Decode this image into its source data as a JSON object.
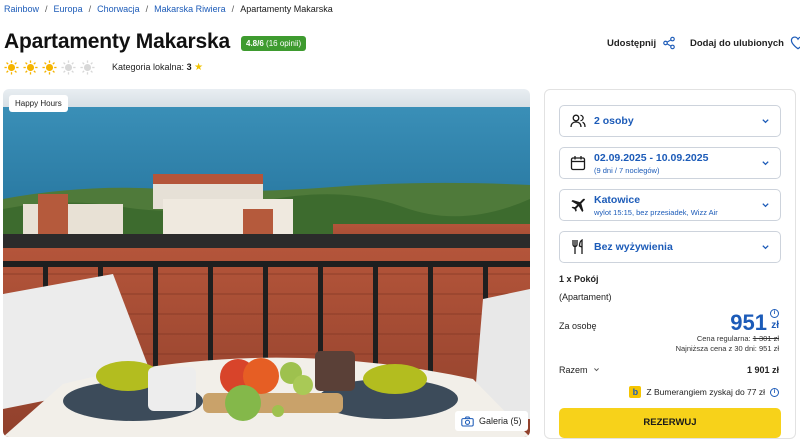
{
  "breadcrumb": {
    "items": [
      "Rainbow",
      "Europa",
      "Chorwacja",
      "Makarska Riwiera"
    ],
    "current": "Apartamenty Makarska",
    "separator": "/"
  },
  "hotel": {
    "name": "Apartamenty Makarska",
    "rating": "4.8/6",
    "rating_count": "(16 opinii)",
    "suns_filled": 3,
    "suns_total": 5,
    "local_category_label": "Kategoria lokalna:",
    "local_category_value": "3",
    "local_category_icon": "star-icon"
  },
  "actions": {
    "share_label": "Udostępnij",
    "favorite_label": "Dodaj do ulubionych"
  },
  "photo": {
    "badge": "Happy Hours",
    "gallery_label": "Galeria (5)"
  },
  "booking": {
    "persons": "2 osoby",
    "dates": "02.09.2025 - 10.09.2025",
    "dates_sub": "(9 dni / 7 noclegów)",
    "departure_city": "Katowice",
    "departure_sub": "wylot 15:15, bez przesiadek, Wizz Air",
    "board": "Bez wyżywienia",
    "room": "1 x Pokój",
    "room_type": "(Apartament)",
    "per_person_label": "Za osobę",
    "price": "951",
    "currency": "zł",
    "regular_price_label": "Cena regularna:",
    "regular_price": "1 301 zł",
    "lowest_price_text": "Najniższa cena z 30 dni: 951 zł",
    "total_label": "Razem",
    "total_value": "1 901 zł",
    "bumerang_text": "Z Bumerangiem zyskaj do 77 zł",
    "reserve_label": "REZERWUJ"
  },
  "colors": {
    "link": "#1c5bb8",
    "rating_badge": "#3e9b2f",
    "reserve_button": "#f7d21a",
    "sun": "#f5b400"
  }
}
